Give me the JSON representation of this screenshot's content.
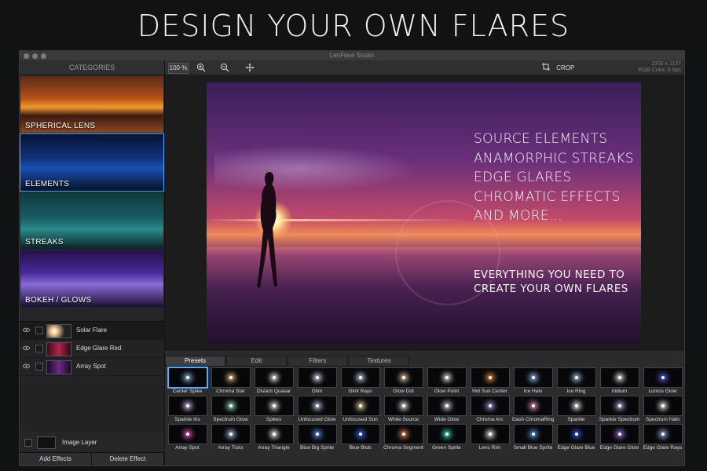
{
  "hero_title": "DESIGN YOUR OWN FLARES",
  "window_title": "LenFlare Studio",
  "sidebar": {
    "header": "CATEGORIES",
    "categories": [
      {
        "label": "SPHERICAL LENS"
      },
      {
        "label": "ELEMENTS"
      },
      {
        "label": "STREAKS"
      },
      {
        "label": "BOKEH / GLOWS"
      }
    ]
  },
  "layers": [
    {
      "name": "Solar Flare"
    },
    {
      "name": "Edge Glare Red"
    },
    {
      "name": "Array Spot"
    }
  ],
  "image_layer": "Image Layer",
  "buttons": {
    "add": "Add Effects",
    "delete": "Delete Effect"
  },
  "toolbar": {
    "zoom": "100 %",
    "crop": "CROP",
    "dims": "1500 x 1137",
    "color": "RGB Color, 8 bpc"
  },
  "image_text": {
    "lines": [
      "SOURCE ELEMENTS",
      "ANAMORPHIC STREAKS",
      "EDGE GLARES",
      "CHROMATIC EFFECTS",
      "AND MORE..."
    ],
    "sub": [
      "EVERYTHING YOU NEED TO",
      "CREATE YOUR OWN FLARES"
    ]
  },
  "tabs": [
    "Presets",
    "Edit",
    "Filters",
    "Textures"
  ],
  "presets": [
    "Center Spike",
    "Chroma Star",
    "Distant Quasar",
    "Glint",
    "Glint Rays",
    "Glow Dot",
    "Glow Point",
    "Hot Sun Center",
    "Ice Halo",
    "Ice Ring",
    "Iridium",
    "Lumos Glow",
    "Sparkle Iris",
    "Spectrum Glow",
    "Spikes",
    "Unfocused Glow",
    "Unfocused Sun",
    "White Source",
    "Wide Glow",
    "Chroma Arc",
    "Dash ChromaRing",
    "Sparkle",
    "Sparkle Spectrum",
    "Spectrum Halo",
    "Array Spot",
    "Array Ticks",
    "Array Triangle",
    "Blue Big Sprite",
    "Blue Blob",
    "Chroma Segment",
    "Green Sprite",
    "Lens Rim",
    "Small Blue Sprite",
    "Edge Glare Blue",
    "Edge Glare Glow",
    "Edge Glare Rays"
  ],
  "colors": {
    "accent": "#4aa3ff",
    "window_bg": "#2b2b2d"
  }
}
